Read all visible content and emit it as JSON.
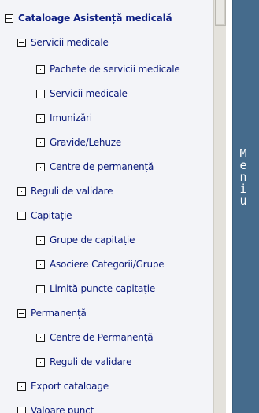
{
  "tree": {
    "root": "Cataloage Asistență medicală",
    "groups": {
      "servicii": {
        "label": "Servicii medicale",
        "items": [
          "Pachete de servicii medicale",
          "Servicii medicale",
          "Imunizări",
          "Gravide/Lehuze",
          "Centre de permanență"
        ]
      },
      "reguli": {
        "label": "Reguli de validare"
      },
      "capitatie": {
        "label": "Capitație",
        "items": [
          "Grupe de capitație",
          "Asociere Categorii/Grupe",
          "Limită puncte capitație"
        ]
      },
      "permanenta": {
        "label": "Permanență",
        "items": [
          "Centre de Permanență",
          "Reguli de validare"
        ]
      },
      "export": {
        "label": "Export cataloage"
      },
      "valoare": {
        "label": "Valoare punct"
      }
    }
  },
  "menu": {
    "letters": [
      "M",
      "e",
      "n",
      "i",
      "u"
    ]
  }
}
